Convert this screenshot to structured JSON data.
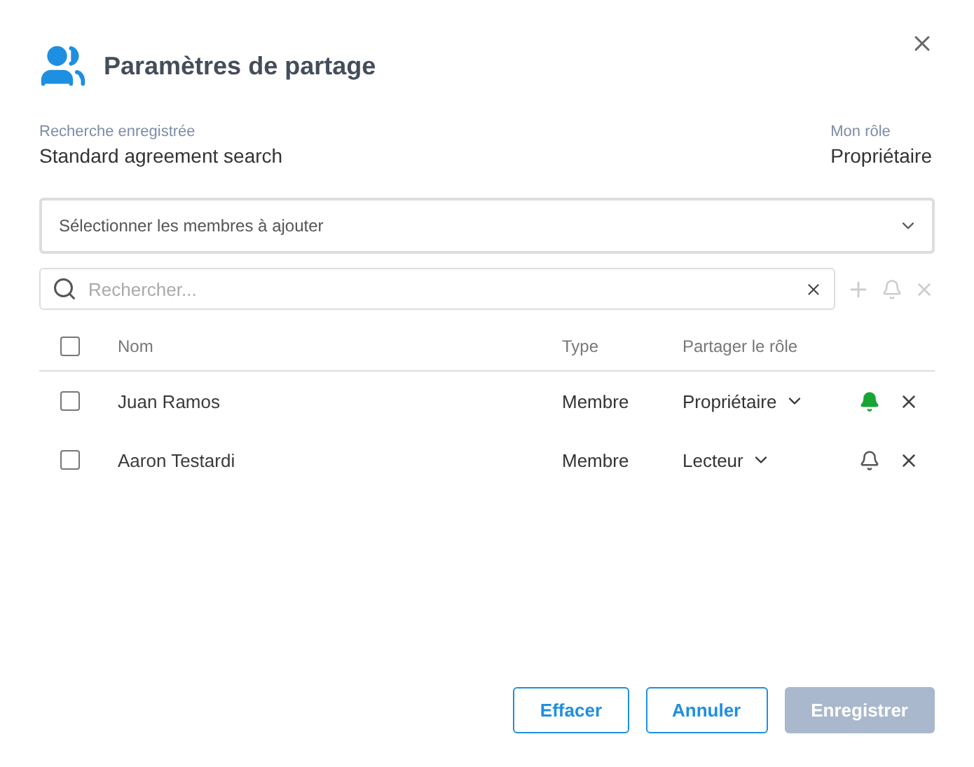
{
  "dialog": {
    "title": "Paramètres de partage"
  },
  "info": [
    {
      "label": "Recherche enregistrée",
      "value": "Standard agreement search"
    },
    {
      "label": "Mon rôle",
      "value": "Propriétaire"
    }
  ],
  "member_select": {
    "placeholder": "Sélectionner les membres à ajouter"
  },
  "search": {
    "placeholder": "Rechercher..."
  },
  "table": {
    "all_checked": false,
    "columns": [
      "Nom",
      "Type",
      "Partager le rôle"
    ],
    "rows": [
      {
        "checked": false,
        "name": "Juan Ramos",
        "type": "Membre",
        "role": "Propriétaire",
        "notify": true
      },
      {
        "checked": false,
        "name": "Aaron Testardi",
        "type": "Membre",
        "role": "Lecteur",
        "notify": false
      }
    ]
  },
  "buttons": [
    {
      "label": "Effacer",
      "kind": "outline",
      "disabled": false
    },
    {
      "label": "Annuler",
      "kind": "outline",
      "disabled": false
    },
    {
      "label": "Enregistrer",
      "kind": "primary",
      "disabled": true
    }
  ]
}
